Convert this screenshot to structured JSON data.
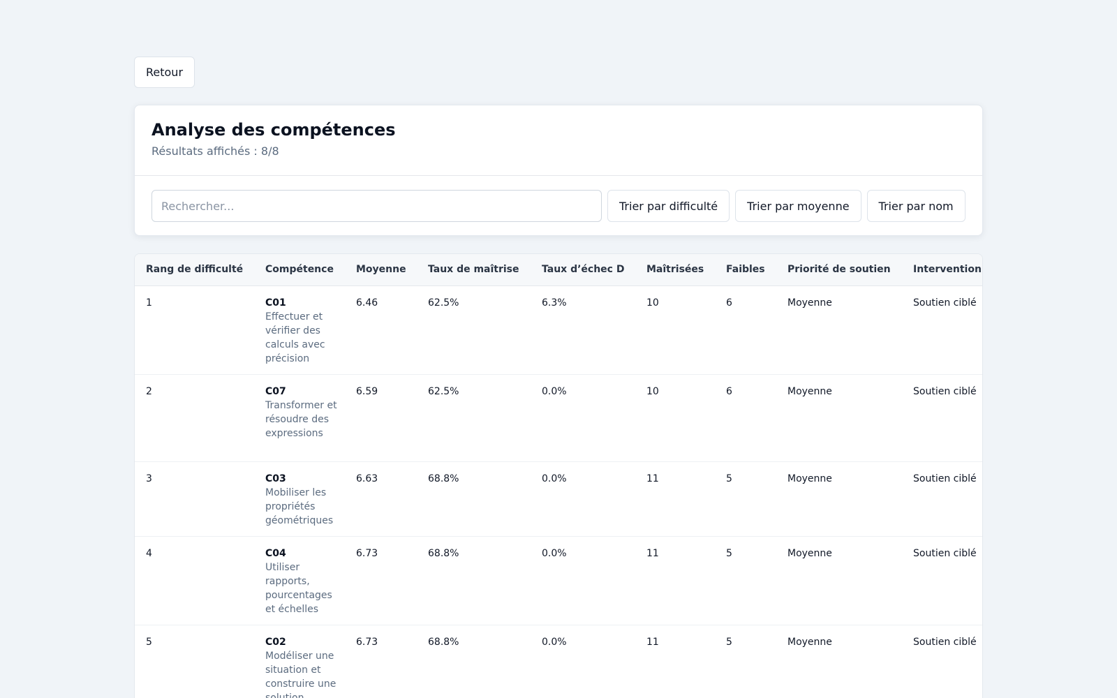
{
  "back_label": "Retour",
  "header": {
    "title": "Analyse des compétences",
    "subtitle": "Résultats affichés : 8/8"
  },
  "toolbar": {
    "search_placeholder": "Rechercher...",
    "sort_difficulty": "Trier par difficulté",
    "sort_average": "Trier par moyenne",
    "sort_name": "Trier par nom"
  },
  "table": {
    "columns": [
      "Rang de difficulté",
      "Compétence",
      "Moyenne",
      "Taux de maîtrise",
      "Taux d’échec D",
      "Maîtrisées",
      "Faibles",
      "Priorité de soutien",
      "Intervention"
    ],
    "rows": [
      {
        "rank": "1",
        "code": "C01",
        "label": "Effectuer et vérifier des calculs avec précision",
        "avg": "6.46",
        "mastery": "62.5%",
        "fail": "6.3%",
        "mastered": "10",
        "weak": "6",
        "priority": "Moyenne",
        "intervention": "Soutien ciblé"
      },
      {
        "rank": "2",
        "code": "C07",
        "label": "Transformer et résoudre des expressions",
        "avg": "6.59",
        "mastery": "62.5%",
        "fail": "0.0%",
        "mastered": "10",
        "weak": "6",
        "priority": "Moyenne",
        "intervention": "Soutien ciblé"
      },
      {
        "rank": "3",
        "code": "C03",
        "label": "Mobiliser les propriétés géométriques",
        "avg": "6.63",
        "mastery": "68.8%",
        "fail": "0.0%",
        "mastered": "11",
        "weak": "5",
        "priority": "Moyenne",
        "intervention": "Soutien ciblé"
      },
      {
        "rank": "4",
        "code": "C04",
        "label": "Utiliser rapports, pourcentages et échelles",
        "avg": "6.73",
        "mastery": "68.8%",
        "fail": "0.0%",
        "mastered": "11",
        "weak": "5",
        "priority": "Moyenne",
        "intervention": "Soutien ciblé"
      },
      {
        "rank": "5",
        "code": "C02",
        "label": "Modéliser une situation et construire une solution",
        "avg": "6.73",
        "mastery": "68.8%",
        "fail": "0.0%",
        "mastered": "11",
        "weak": "5",
        "priority": "Moyenne",
        "intervention": "Soutien ciblé"
      }
    ]
  }
}
